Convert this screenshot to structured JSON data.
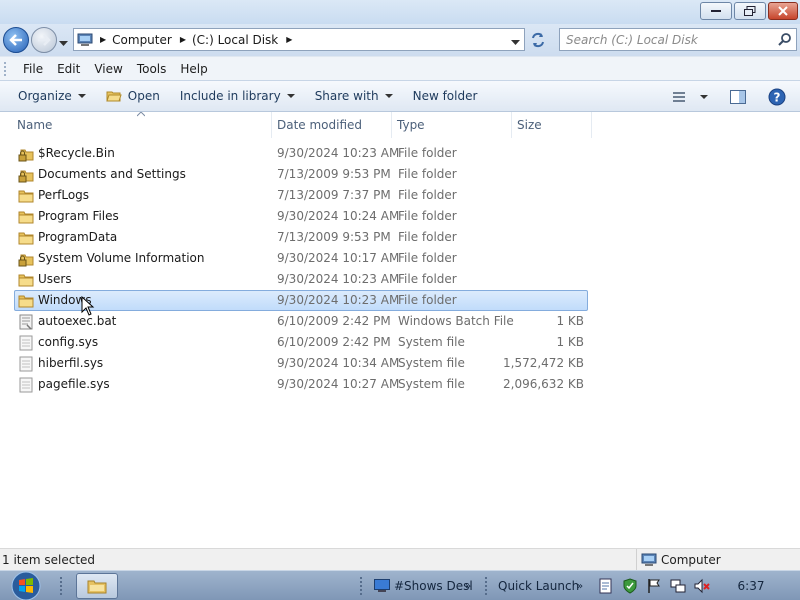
{
  "window": {
    "controls": [
      "minimize",
      "restore",
      "close"
    ]
  },
  "address": {
    "crumbs": [
      "Computer",
      "(C:) Local Disk"
    ],
    "search_placeholder": "Search (C:) Local Disk"
  },
  "menu": {
    "items": [
      "File",
      "Edit",
      "View",
      "Tools",
      "Help"
    ]
  },
  "commands": {
    "organize": "Organize",
    "open": "Open",
    "include_in_library": "Include in library",
    "share_with": "Share with",
    "new_folder": "New folder"
  },
  "columns": {
    "name": "Name",
    "date_modified": "Date modified",
    "type": "Type",
    "size": "Size"
  },
  "files": [
    {
      "name": "$Recycle.Bin",
      "date": "9/30/2024 10:23 AM",
      "type": "File folder",
      "size": "",
      "icon": "locked-folder-icon"
    },
    {
      "name": "Documents and Settings",
      "date": "7/13/2009 9:53 PM",
      "type": "File folder",
      "size": "",
      "icon": "locked-folder-icon"
    },
    {
      "name": "PerfLogs",
      "date": "7/13/2009 7:37 PM",
      "type": "File folder",
      "size": "",
      "icon": "folder-icon"
    },
    {
      "name": "Program Files",
      "date": "9/30/2024 10:24 AM",
      "type": "File folder",
      "size": "",
      "icon": "folder-icon"
    },
    {
      "name": "ProgramData",
      "date": "7/13/2009 9:53 PM",
      "type": "File folder",
      "size": "",
      "icon": "folder-icon"
    },
    {
      "name": "System Volume Information",
      "date": "9/30/2024 10:17 AM",
      "type": "File folder",
      "size": "",
      "icon": "locked-folder-icon"
    },
    {
      "name": "Users",
      "date": "9/30/2024 10:23 AM",
      "type": "File folder",
      "size": "",
      "icon": "folder-icon"
    },
    {
      "name": "Windows",
      "date": "9/30/2024 10:23 AM",
      "type": "File folder",
      "size": "",
      "icon": "folder-icon",
      "selected": true
    },
    {
      "name": "autoexec.bat",
      "date": "6/10/2009 2:42 PM",
      "type": "Windows Batch File",
      "size": "1 KB",
      "icon": "batch-file-icon"
    },
    {
      "name": "config.sys",
      "date": "6/10/2009 2:42 PM",
      "type": "System file",
      "size": "1 KB",
      "icon": "system-file-icon"
    },
    {
      "name": "hiberfil.sys",
      "date": "9/30/2024 10:34 AM",
      "type": "System file",
      "size": "1,572,472 KB",
      "icon": "system-file-icon"
    },
    {
      "name": "pagefile.sys",
      "date": "9/30/2024 10:27 AM",
      "type": "System file",
      "size": "2,096,632 KB",
      "icon": "system-file-icon"
    }
  ],
  "status": {
    "selection": "1 item selected",
    "location": "Computer"
  },
  "taskbar": {
    "desktop_item": "#Shows Desl",
    "quick_launch": "Quick Launch",
    "clock": "6:37"
  }
}
